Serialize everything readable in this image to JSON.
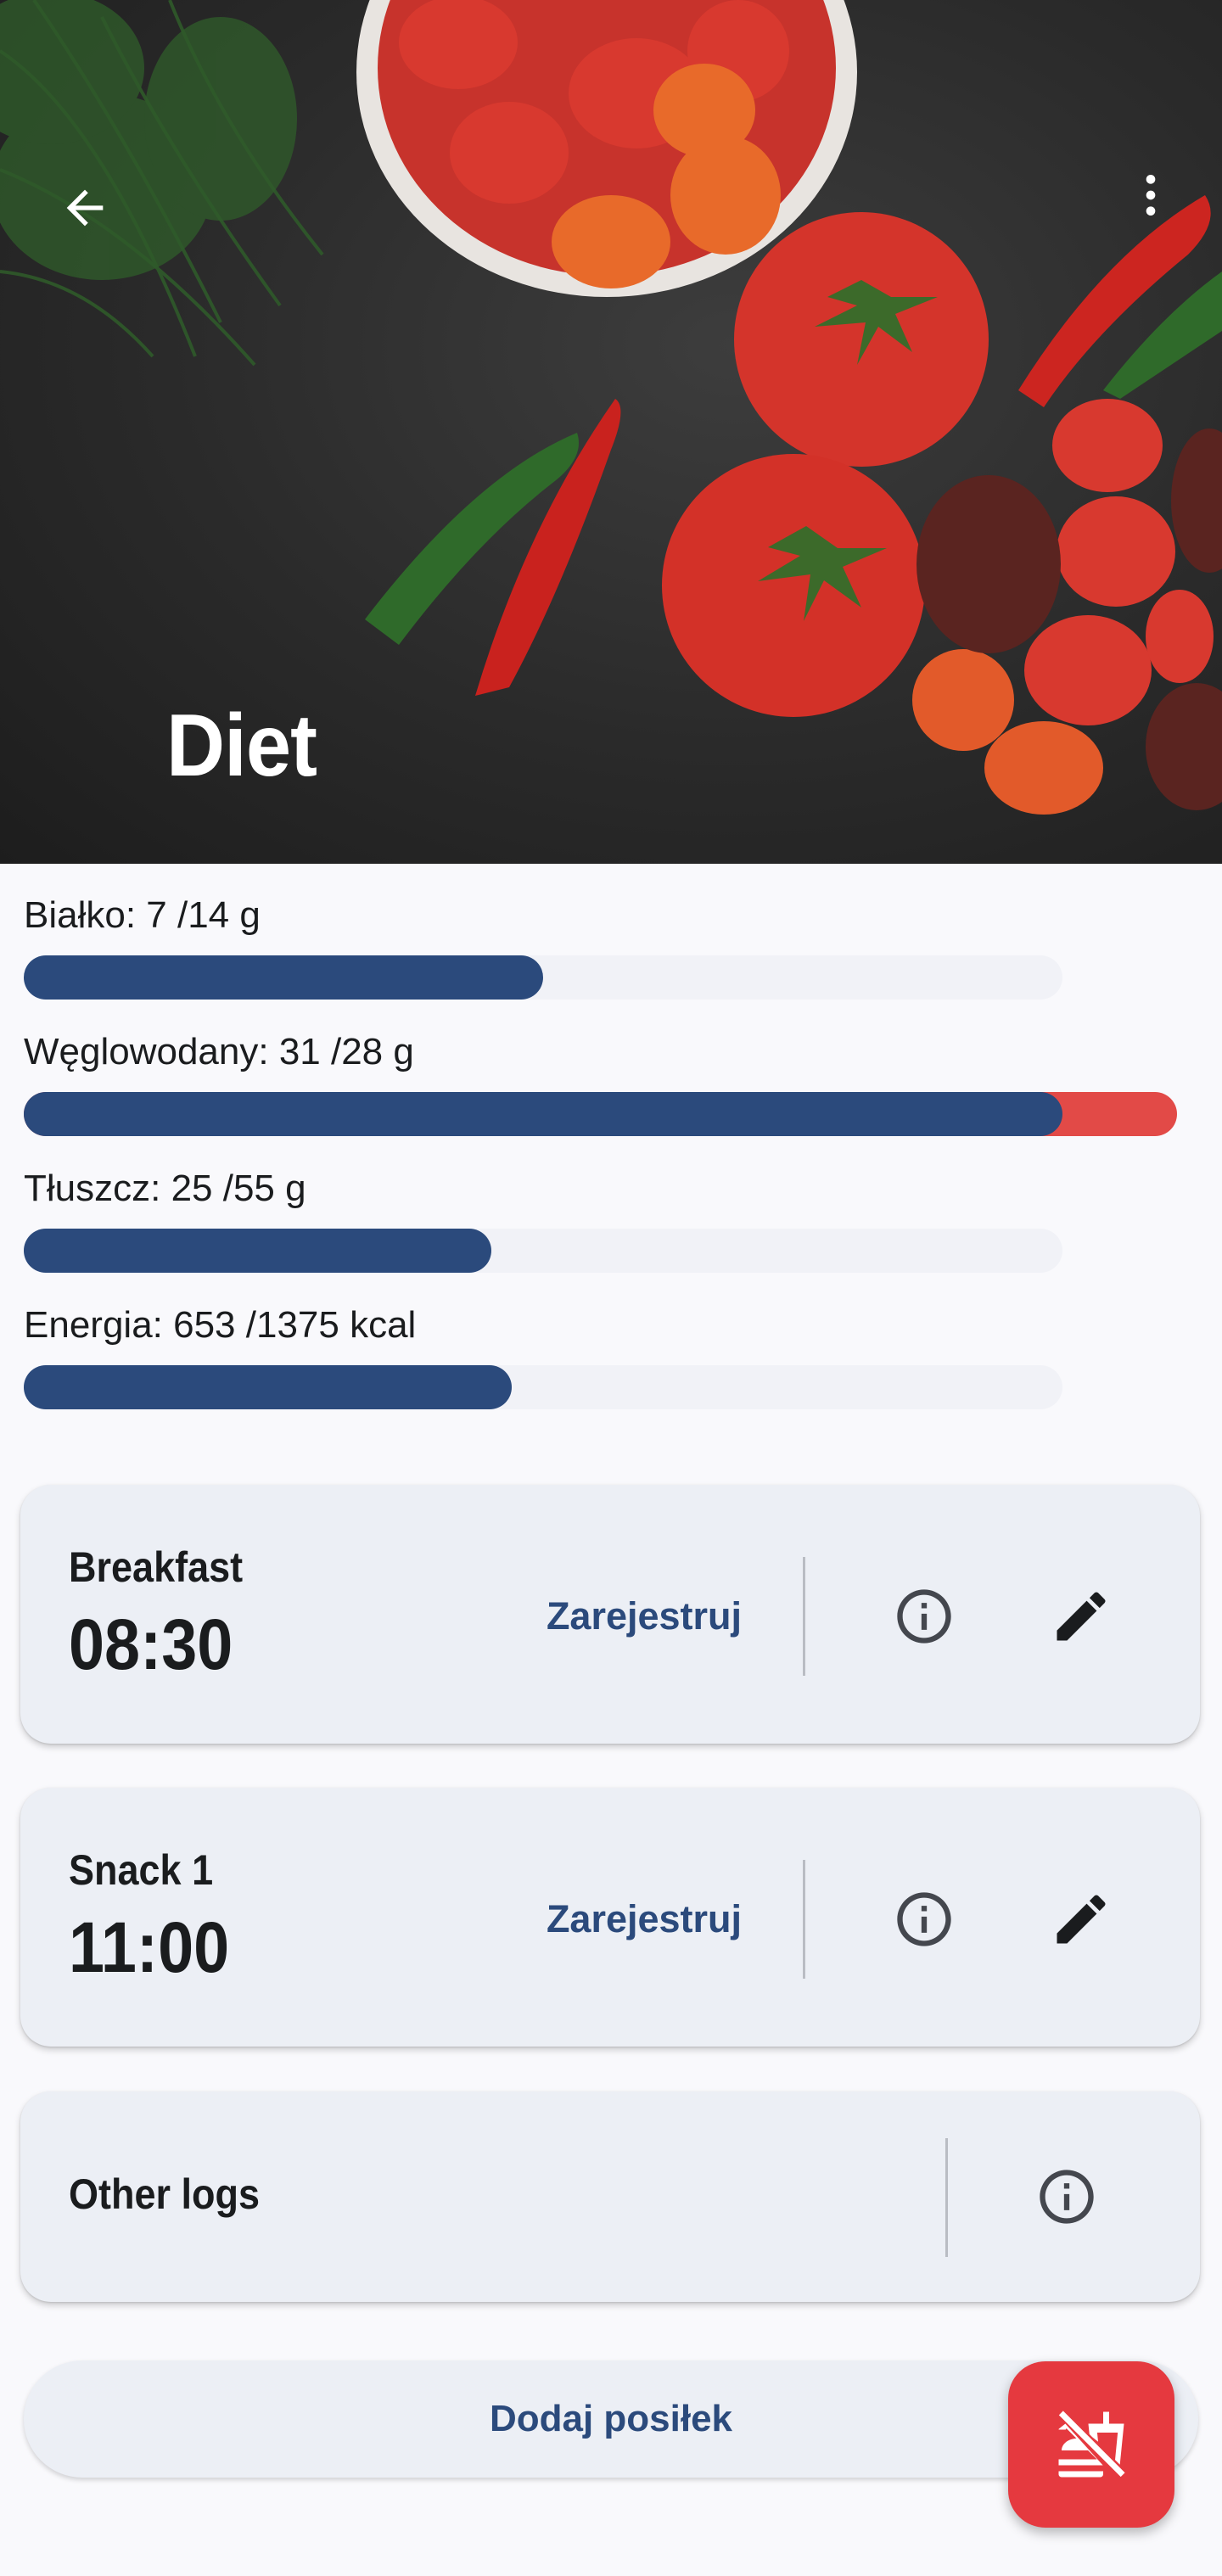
{
  "header": {
    "title": "Diet",
    "back_icon": "arrow-left-icon",
    "more_icon": "more-vert-icon"
  },
  "macros": [
    {
      "label": "Białko: 7 /14 g",
      "value": 7,
      "target": 14,
      "progress": 0.5
    },
    {
      "label": "Węglowodany: 31 /28 g",
      "value": 31,
      "target": 28,
      "progress": 1.11
    },
    {
      "label": "Tłuszcz: 25 /55 g",
      "value": 25,
      "target": 55,
      "progress": 0.45
    },
    {
      "label": "Energia: 653 /1375 kcal",
      "value": 653,
      "target": 1375,
      "progress": 0.47
    }
  ],
  "meals": [
    {
      "name": "Breakfast",
      "time": "08:30",
      "register_label": "Zarejestruj"
    },
    {
      "name": "Snack 1",
      "time": "11:00",
      "register_label": "Zarejestruj"
    }
  ],
  "other_logs": {
    "label": "Other logs"
  },
  "add_meal": {
    "label": "Dodaj posiłek"
  },
  "colors": {
    "primary": "#2b4a7c",
    "over_limit": "#e24a47",
    "fab": "#e5393f",
    "card": "#eceff5",
    "track": "#f1f2f7"
  },
  "icons": {
    "info": "info-icon",
    "edit": "edit-pencil-icon",
    "fab": "no-food-icon"
  }
}
